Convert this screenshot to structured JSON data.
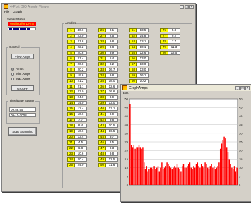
{
  "main_window": {
    "title": "4-Port DIO Anode Viewer",
    "menu": [
      "File",
      "Graph"
    ],
    "serial_status": {
      "label": "Serial Status",
      "message": "Waiting for DATA",
      "progress_blocks": 6
    },
    "control": {
      "label": "Control",
      "view_button": "View Amps",
      "radios": [
        {
          "label": "Amps",
          "selected": true
        },
        {
          "label": "Min. Amps",
          "selected": false
        },
        {
          "label": "Max Amps",
          "selected": false
        }
      ],
      "graph_button": "GRAPH"
    },
    "timestamp": {
      "label": "Time/Date Stamp",
      "time": "09:58:55",
      "date": "09-11-2008"
    },
    "start_button": "Start Scanning",
    "anodes": {
      "label": "Anodes",
      "columns": [
        [
          [
            "1",
            "40.6"
          ],
          [
            "2",
            "23.0"
          ],
          [
            "3",
            "21.8"
          ],
          [
            "4",
            "22.2"
          ],
          [
            "5",
            "20.6"
          ],
          [
            "6",
            "21.4"
          ],
          [
            "7",
            "20.8"
          ],
          [
            "8",
            "20.2"
          ],
          [
            "9",
            "19.6"
          ],
          [
            "10",
            "21.2"
          ],
          [
            "11",
            "21.1"
          ],
          [
            "12",
            "23.0"
          ],
          [
            "13",
            "24.0"
          ],
          [
            "14",
            "14.0"
          ],
          [
            "15",
            "12.4"
          ],
          [
            "16",
            "10.6"
          ],
          [
            "17",
            "7.7"
          ],
          [
            "18",
            "8.4"
          ],
          [
            "19",
            "10.6"
          ],
          [
            "20",
            "13.4"
          ],
          [
            "21",
            "4.5"
          ],
          [
            "22",
            "6.8"
          ],
          [
            "23",
            "10.6"
          ],
          [
            "24",
            "20.4"
          ],
          [
            "25",
            "24.0"
          ]
        ],
        [
          [
            "26",
            "9.1"
          ],
          [
            "27",
            "2.5"
          ],
          [
            "28",
            "9.8"
          ],
          [
            "29",
            "9.8"
          ],
          [
            "30",
            "9.9"
          ],
          [
            "31",
            "6.4"
          ],
          [
            "32",
            "8.2"
          ],
          [
            "33",
            "16.7"
          ],
          [
            "34",
            "9.8"
          ],
          [
            "35",
            "18.0"
          ],
          [
            "36",
            "12.6"
          ],
          [
            "37",
            "26.6"
          ],
          [
            "38",
            "9.9"
          ],
          [
            "39",
            "13.0"
          ],
          [
            "40",
            "13.1"
          ],
          [
            "41",
            "9.9"
          ],
          [
            "42",
            "9.8"
          ],
          [
            "43",
            "10.5"
          ],
          [
            "44",
            "16.5"
          ],
          [
            "45",
            "9.7"
          ],
          [
            "46",
            "8.5"
          ],
          [
            "47",
            "9.3"
          ],
          [
            "48",
            "9.8"
          ],
          [
            "49",
            "12.5"
          ],
          [
            "50",
            "11.6"
          ]
        ],
        [
          [
            "51",
            "13.5"
          ],
          [
            "52",
            "14.8"
          ],
          [
            "53",
            "13.1"
          ],
          [
            "54",
            "10.1"
          ],
          [
            "55",
            "12.6"
          ],
          [
            "56",
            "13.0"
          ],
          [
            "57",
            "13.0"
          ],
          [
            "58",
            "13.0"
          ],
          [
            "59",
            "16.1"
          ],
          [
            "60",
            "10.2"
          ],
          [
            "61",
            "10.0"
          ]
        ],
        [
          [
            "76",
            "5.8"
          ],
          [
            "77",
            "9.2"
          ],
          [
            "78",
            "7.7"
          ],
          [
            "79",
            "11.3"
          ],
          [
            "80",
            "12.5"
          ]
        ]
      ]
    }
  },
  "graph_window": {
    "title": "GraphAmps",
    "menu": [
      "Exit"
    ],
    "chart_data": {
      "type": "bar",
      "ylim": [
        0,
        50
      ],
      "y_ticks": [
        "0",
        "5",
        "10",
        "15",
        "20",
        "25",
        "30",
        "35",
        "40",
        "45",
        "50"
      ],
      "values": [
        47,
        23,
        22,
        23,
        21,
        22,
        22,
        23,
        22,
        21,
        22,
        13,
        9,
        11,
        8,
        9,
        10,
        10,
        9,
        11,
        9,
        10,
        11,
        8,
        10,
        13,
        9,
        10,
        11,
        13,
        12,
        11,
        10,
        9,
        10,
        11,
        10,
        12,
        10,
        9,
        8,
        11,
        12,
        10,
        10,
        11,
        12,
        13,
        10,
        9,
        11,
        10,
        12,
        13,
        11,
        10,
        12,
        11,
        10,
        13,
        12,
        10,
        9,
        11,
        12,
        10,
        11,
        9,
        10,
        11,
        13,
        21,
        24,
        26,
        28,
        27,
        22,
        19,
        15,
        12,
        10,
        9,
        11,
        8,
        10
      ]
    }
  },
  "colors": {
    "bar": "#ff0000",
    "status_bg": "#ff0000",
    "status_text": "#ffff00",
    "index_cell": "#ffff00",
    "progress_block": "#000080",
    "plot_bg": "#ffffff"
  }
}
